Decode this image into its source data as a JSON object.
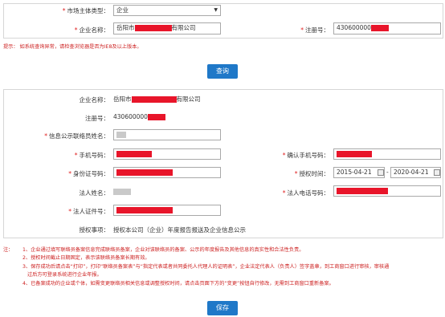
{
  "top_form": {
    "entity_type_label": "市场主体类型：",
    "entity_type_value": "企业",
    "company_name_label": "企业名称：",
    "company_name_value_prefix": "岳阳市",
    "company_name_value_suffix": "有限公司",
    "reg_no_label": "注册号：",
    "reg_no_value_prefix": "430600000"
  },
  "hint": "提示：  如系统查询异常，请检查浏览器是否为IE8及以上版本。",
  "query_button": "查询",
  "detail_form": {
    "company_name_label": "企业名称：",
    "company_name_value_prefix": "岳阳市",
    "company_name_value_suffix": "有限公司",
    "reg_no_label": "注册号：",
    "reg_no_value_prefix": "430600000",
    "liaison_name_label": "信息公示联络员姓名：",
    "phone_label": "手机号码：",
    "confirm_phone_label": "确认手机号码：",
    "id_no_label": "身份证号码：",
    "auth_time_label": "授权时间：",
    "auth_start": "2015-04-21",
    "auth_sep": "-",
    "auth_end": "2020-04-21",
    "legal_name_label": "法人姓名：",
    "legal_phone_label": "法人电话号码：",
    "legal_id_label": "法人证件号：",
    "auth_item_label": "授权事项：",
    "auth_item_value": "授权本公司（企业）年度报告报送及企业信息公示"
  },
  "notes": {
    "prefix": "注：",
    "items": [
      "1、企业通过填写联络员备案信息完成联络员备案，企业对该联络员的备案、公示的年度报告及其他信息的真实性和合法性负责。",
      "2、授权时间截止日期固定，表示该联络员备案长期有效。",
      "3、保存成功后请点击“打印”，打印“联络员备案表”与“指定代表或者共同委托人代理人的证明表”，企业法定代表人（负责人）签字盖章，到工商窗口进行审核，审核通",
      "过后方可登录系统进行企业年报。",
      "4、已备案成功的企业或个体，如需变更联络员相关信息或调整授权时间，请点击页面下方的“变更”按钮自行修改，无需到工商窗口重新备案。"
    ]
  },
  "save_button": "保存",
  "colors": {
    "accent": "#1f78c8",
    "required": "#e02020",
    "redaction": "#e8152a"
  }
}
